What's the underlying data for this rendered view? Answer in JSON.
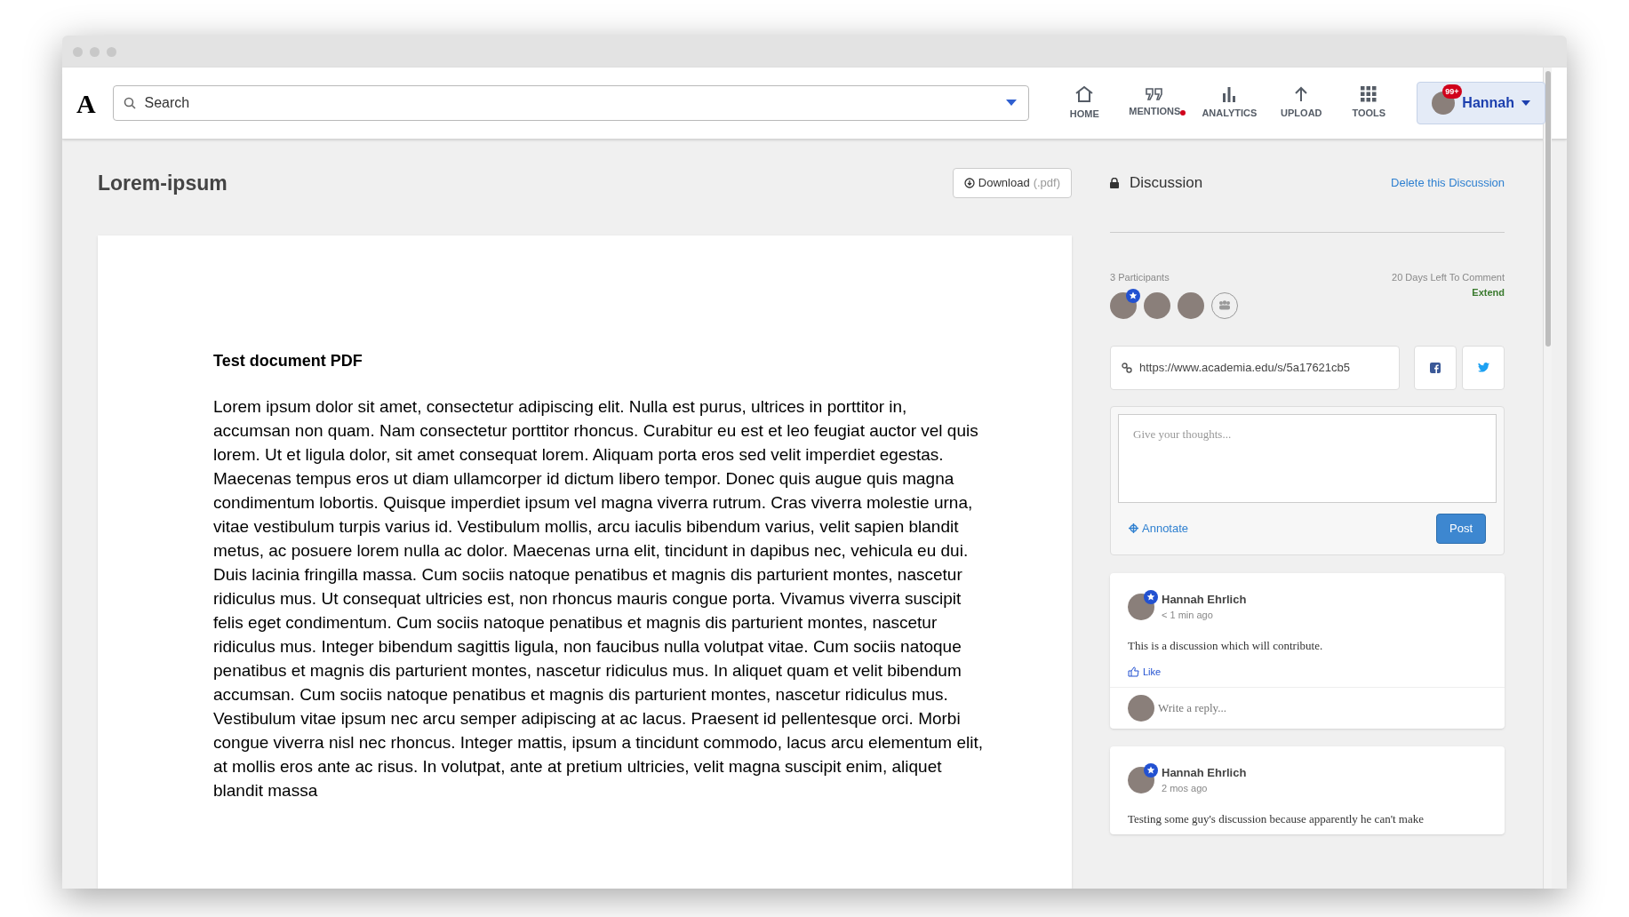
{
  "navbar": {
    "logo": "A",
    "search": {
      "placeholder": "Search"
    },
    "items": [
      {
        "label": "HOME",
        "notification": false
      },
      {
        "label": "MENTIONS",
        "notification": true
      },
      {
        "label": "ANALYTICS",
        "notification": false
      },
      {
        "label": "UPLOAD",
        "notification": false
      },
      {
        "label": "TOOLS",
        "notification": false
      }
    ],
    "user": {
      "name": "Hannah",
      "badge": "99+"
    }
  },
  "document": {
    "title": "Lorem-ipsum",
    "download": {
      "label": "Download",
      "suffix": "(.pdf)"
    },
    "heading": "Test document PDF",
    "body": "Lorem ipsum dolor sit amet, consectetur adipiscing elit. Nulla est purus, ultrices in porttitor in, accumsan non quam. Nam consectetur porttitor rhoncus. Curabitur eu est et leo feugiat auctor vel quis lorem. Ut et ligula dolor, sit amet consequat lorem. Aliquam porta eros sed velit imperdiet egestas. Maecenas tempus eros ut diam ullamcorper id dictum libero tempor. Donec quis augue quis magna condimentum lobortis. Quisque imperdiet ipsum vel magna viverra rutrum. Cras viverra molestie urna, vitae vestibulum turpis varius id. Vestibulum mollis, arcu iaculis bibendum varius, velit sapien blandit metus, ac posuere lorem nulla ac dolor. Maecenas urna elit, tincidunt in dapibus nec, vehicula eu dui. Duis lacinia fringilla massa. Cum sociis natoque penatibus et magnis dis parturient montes, nascetur ridiculus mus. Ut consequat ultricies est, non rhoncus mauris congue porta. Vivamus viverra suscipit felis eget condimentum. Cum sociis natoque penatibus et magnis dis parturient montes, nascetur ridiculus mus. Integer bibendum sagittis ligula, non faucibus nulla volutpat vitae. Cum sociis natoque penatibus et magnis dis parturient montes, nascetur ridiculus mus. In aliquet quam et velit bibendum accumsan. Cum sociis natoque penatibus et magnis dis parturient montes, nascetur ridiculus mus. Vestibulum vitae ipsum nec arcu semper adipiscing at ac lacus. Praesent id pellentesque orci. Morbi congue viverra nisl nec rhoncus. Integer mattis, ipsum a tincidunt commodo, lacus arcu elementum elit, at mollis eros ante ac risus. In volutpat, ante at pretium ultricies, velit magna suscipit enim, aliquet blandit massa"
  },
  "discussion": {
    "title": "Discussion",
    "delete_link": "Delete this Discussion",
    "participants_label": "3 Participants",
    "days_left": "20 Days Left To Comment",
    "extend_link": "Extend",
    "participants": [
      {
        "moderator": true
      },
      {
        "moderator": false
      },
      {
        "moderator": false
      }
    ],
    "share_url": "https://www.academia.edu/s/5a17621cb5",
    "comment_box": {
      "placeholder": "Give your thoughts...",
      "annotate": "Annotate",
      "post": "Post"
    },
    "comments": [
      {
        "author": "Hannah Ehrlich",
        "time": "< 1 min ago",
        "text": "This is a discussion which will contribute.",
        "like": "Like",
        "reply_placeholder": "Write a reply..."
      },
      {
        "author": "Hannah Ehrlich",
        "time": "2 mos ago",
        "text": "Testing some guy's discussion because apparently he can't make"
      }
    ]
  }
}
